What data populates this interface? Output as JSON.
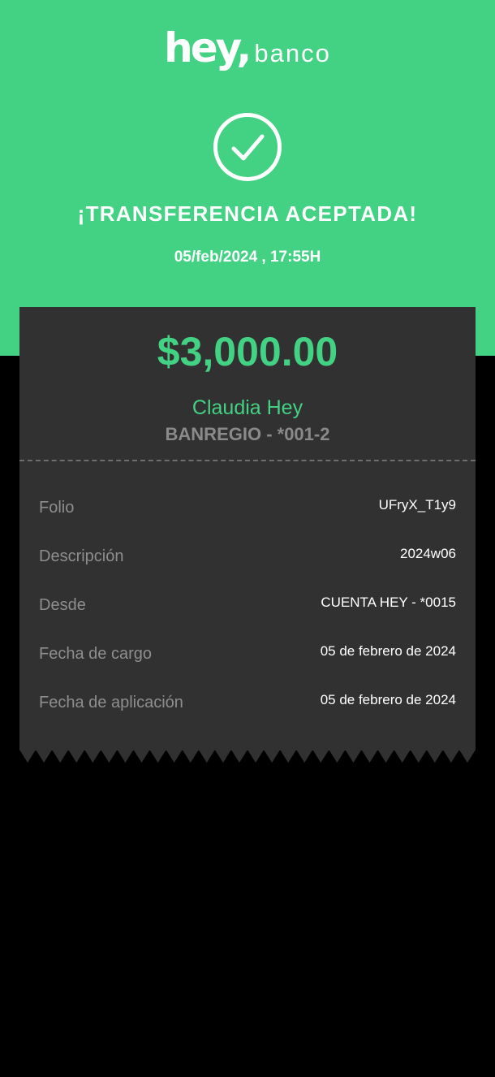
{
  "brand": {
    "logo_primary": "hey,",
    "logo_secondary": "banco",
    "accent_color": "#43d184",
    "card_color": "#313131"
  },
  "status": {
    "icon": "check-circle-icon",
    "title": "¡TRANSFERENCIA ACEPTADA!",
    "datetime": "05/feb/2024 , 17:55H"
  },
  "transfer": {
    "amount": "$3,000.00",
    "recipient_name": "Claudia Hey",
    "recipient_account": "BANREGIO - *001-2"
  },
  "details": [
    {
      "label": "Folio",
      "value": "UFryX_T1y9"
    },
    {
      "label": "Descripción",
      "value": "2024w06"
    },
    {
      "label": "Desde",
      "value": "CUENTA HEY - *0015"
    },
    {
      "label": "Fecha de cargo",
      "value": "05 de febrero de 2024"
    },
    {
      "label": "Fecha de aplicación",
      "value": "05 de febrero de 2024"
    }
  ]
}
